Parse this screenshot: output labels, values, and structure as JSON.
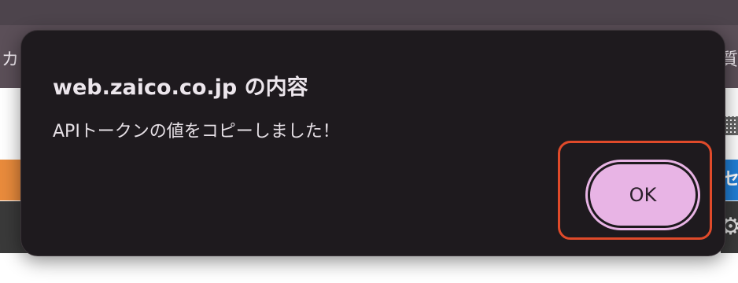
{
  "background": {
    "nav_left_text": "カ",
    "nav_right_text": "質",
    "right_blue_text": "セ"
  },
  "dialog": {
    "title": "web.zaico.co.jp の内容",
    "message": "APIトークンの値をコピーしました！",
    "ok_label": "OK"
  },
  "colors": {
    "dialog_background": "#1e1a1e",
    "button_background": "#e8b4e5",
    "focus_highlight": "#e04a2a"
  }
}
